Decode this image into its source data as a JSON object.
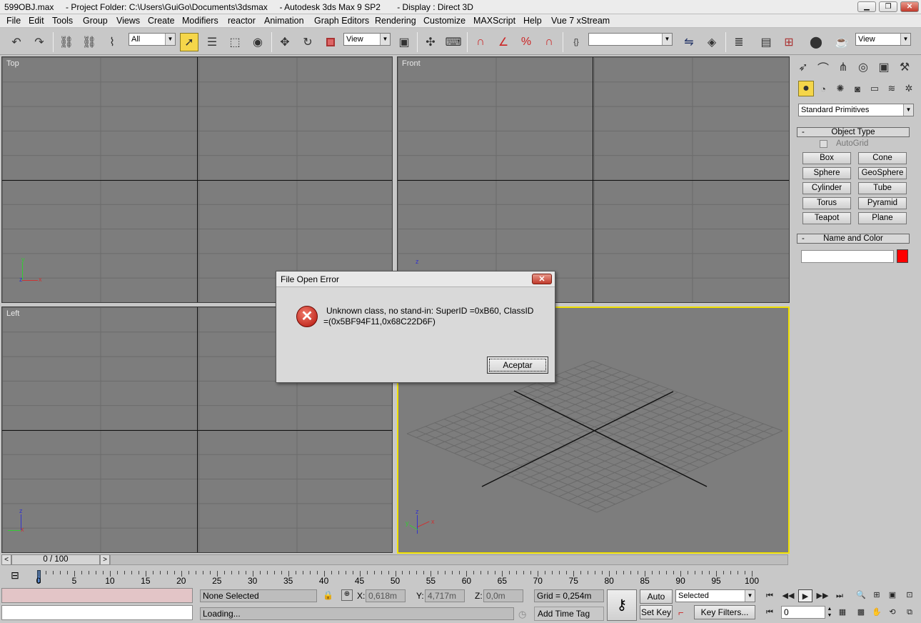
{
  "window": {
    "title": "599OBJ.max     - Project Folder: C:\\Users\\GuiGo\\Documents\\3dsmax     - Autodesk 3ds Max 9 SP2       - Display : Direct 3D",
    "min": "▁",
    "max": "❐",
    "close": "✕"
  },
  "menu": [
    "File",
    "Edit",
    "Tools",
    "Group",
    "Views",
    "Create",
    "Modifiers",
    "reactor",
    "Animation",
    "Graph Editors",
    "Rendering",
    "Customize",
    "MAXScript",
    "Help",
    "Vue 7 xStream"
  ],
  "toolbar": {
    "selection_filter": "All",
    "ref_coord": "View",
    "named_selection": "",
    "view_combo": "View"
  },
  "viewports": {
    "top": "Top",
    "front": "Front",
    "left": "Left",
    "perspective": ""
  },
  "command_panel": {
    "category": "Standard Primitives",
    "object_type_header": "Object Type",
    "autogrid": "AutoGrid",
    "primitives": [
      "Box",
      "Cone",
      "Sphere",
      "GeoSphere",
      "Cylinder",
      "Tube",
      "Torus",
      "Pyramid",
      "Teapot",
      "Plane"
    ],
    "name_color_header": "Name and Color",
    "object_name": "",
    "object_color": "#ff0000"
  },
  "dialog": {
    "title": "File Open Error",
    "message_line1": "Unknown class, no stand-in: SuperID =0xB60, ClassID",
    "message_line2": "=(0x5BF94F11,0x68C22D6F)",
    "ok_label": "Aceptar"
  },
  "timeline": {
    "slider_label": "0 / 100",
    "ticks": [
      "0",
      "5",
      "10",
      "15",
      "20",
      "25",
      "30",
      "35",
      "40",
      "45",
      "50",
      "55",
      "60",
      "65",
      "70",
      "75",
      "80",
      "85",
      "90",
      "95",
      "100"
    ]
  },
  "status": {
    "selection": "None Selected",
    "prompt": "Loading...",
    "x_label": "X:",
    "x_value": "0,618m",
    "y_label": "Y:",
    "y_value": "4,717m",
    "z_label": "Z:",
    "z_value": "0,0m",
    "grid": "Grid = 0,254m",
    "add_time_tag": "Add Time Tag",
    "auto_key": "Auto Key",
    "set_key": "Set Key",
    "key_mode": "Selected",
    "key_filters": "Key Filters...",
    "frame": "0"
  }
}
